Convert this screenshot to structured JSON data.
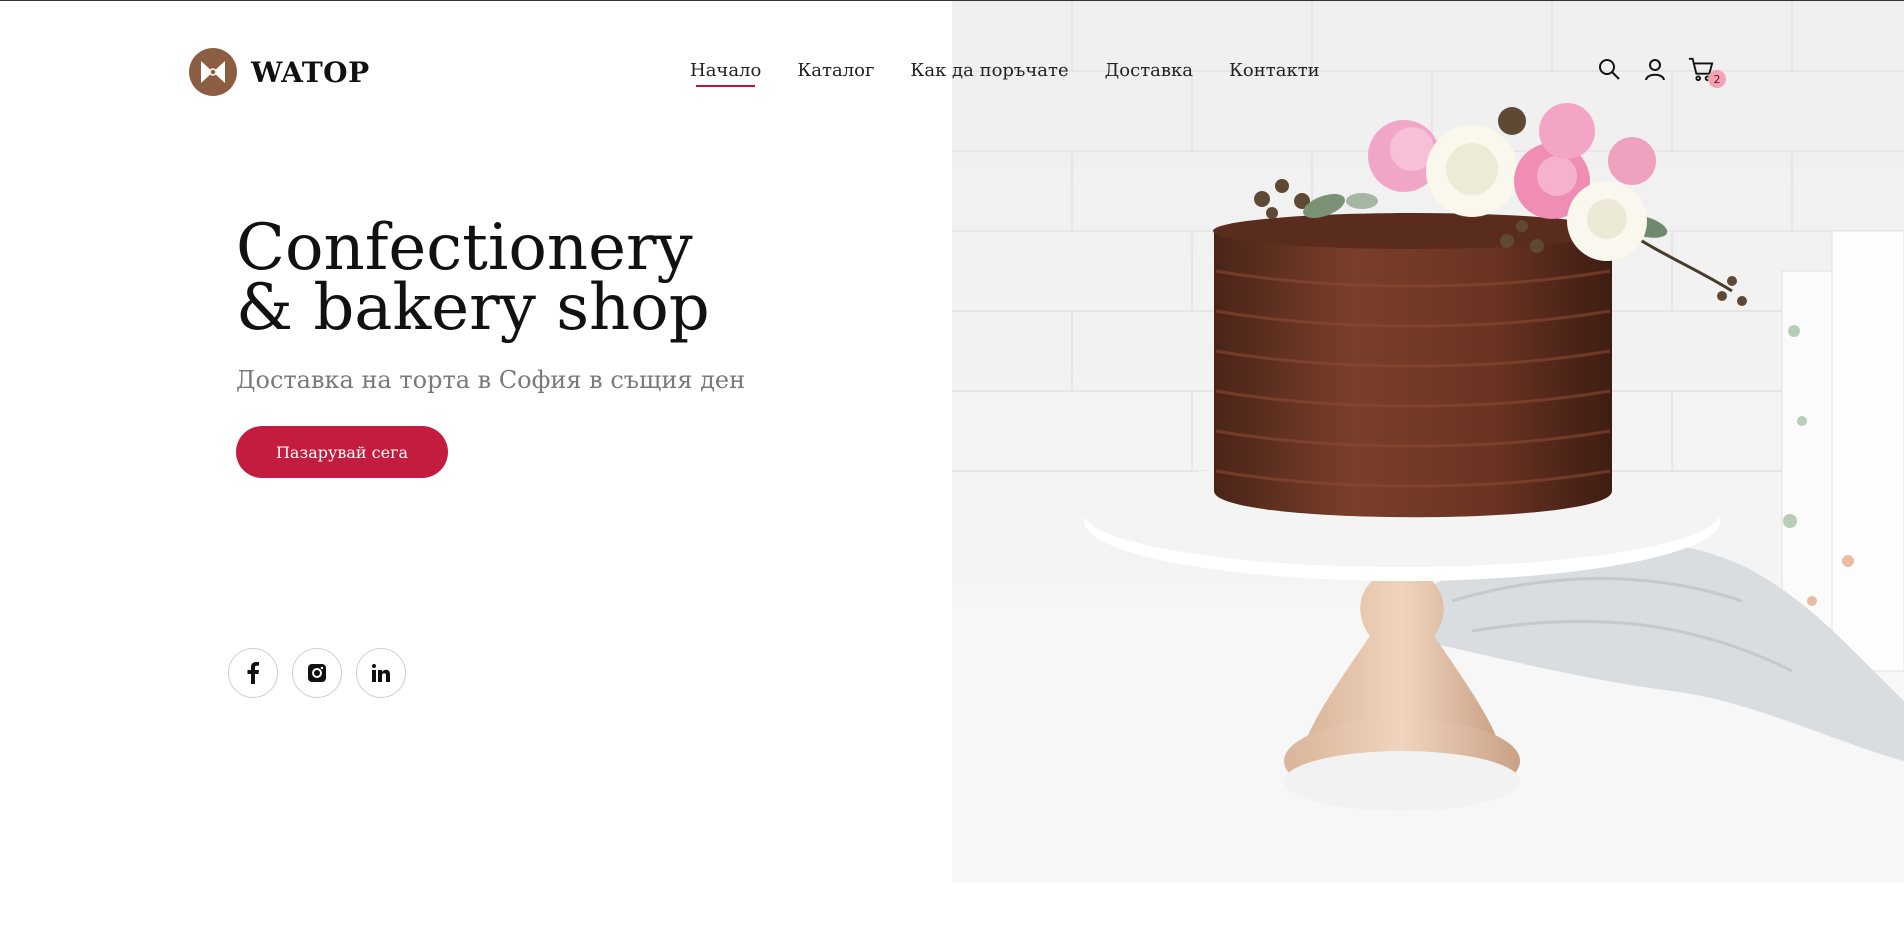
{
  "brand": {
    "name": "WATOP",
    "logo_icon": "bow-icon"
  },
  "nav": {
    "items": [
      {
        "label": "Начало",
        "active": true
      },
      {
        "label": "Каталог"
      },
      {
        "label": "Как да поръчате"
      },
      {
        "label": "Доставка"
      },
      {
        "label": "Контакти"
      }
    ]
  },
  "header_icons": {
    "search": "search-icon",
    "account": "user-icon",
    "cart": "cart-icon",
    "cart_count": "2"
  },
  "hero": {
    "title_line1": "Confectionery",
    "title_line2": "& bakery shop",
    "subtitle": "Доставка на торта в София в същия ден",
    "cta_label": "Пазарувай сега"
  },
  "social": [
    "facebook-icon",
    "instagram-icon",
    "linkedin-icon"
  ],
  "colors": {
    "accent": "#c41c3f",
    "logo_bg": "#8b5e44",
    "nav_underline": "#c8102e",
    "badge": "#f4a3b4"
  }
}
